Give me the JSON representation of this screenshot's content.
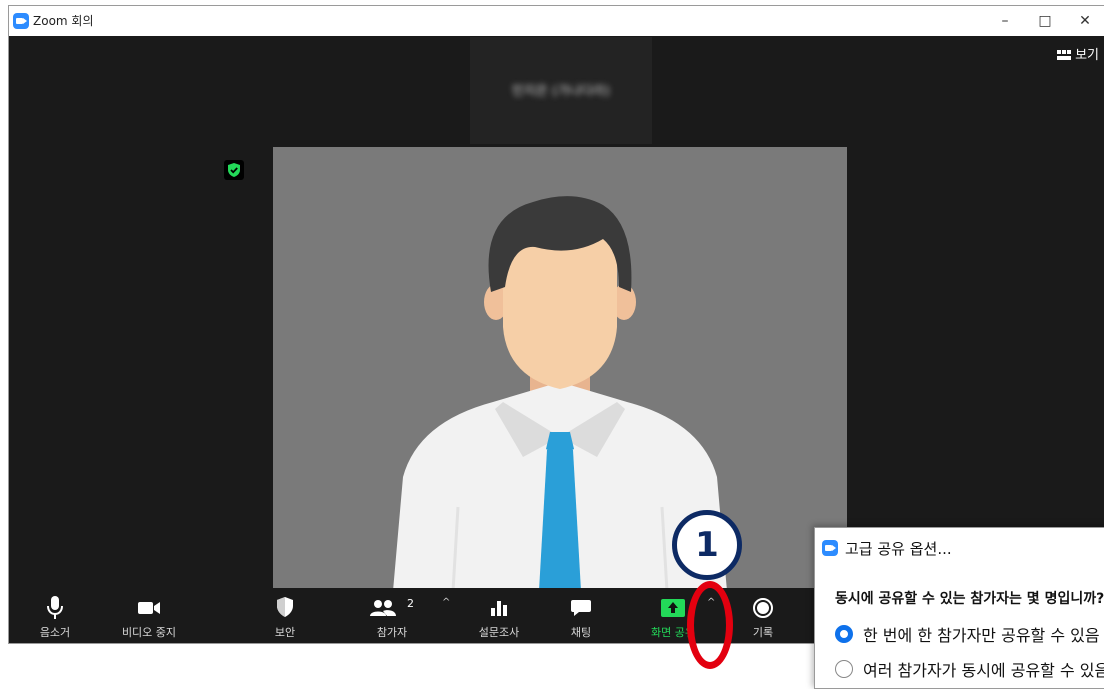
{
  "window": {
    "title": "Zoom 회의",
    "controls": {
      "minimize": "–",
      "maximize": "□",
      "close": "✕"
    }
  },
  "meeting": {
    "participant_name": "민지은 (가나다라)",
    "view_label": "보기",
    "accent_green": "#23d959",
    "video_bg": "#7a7a7a"
  },
  "toolbar": {
    "mute": "음소거",
    "stop_video": "비디오 중지",
    "security": "보안",
    "participants": "참가자",
    "participants_count": "2",
    "polls": "설문조사",
    "chat": "채팅",
    "share_screen": "화면 공유",
    "record": "기록",
    "caret": "^"
  },
  "annotation": {
    "step_number": "1",
    "highlight_color": "#e3000f",
    "badge_color": "#0d2a64"
  },
  "advanced_sharing_dialog": {
    "title": "고급 공유 옵션...",
    "question": "동시에 공유할 수 있는 참가자는 몇 명입니까?",
    "options": [
      {
        "label": "한 번에 한 참가자만 공유할 수 있음",
        "selected": true
      },
      {
        "label": "여러 참가자가 동시에 공유할 수 있음",
        "selected": false
      }
    ]
  }
}
